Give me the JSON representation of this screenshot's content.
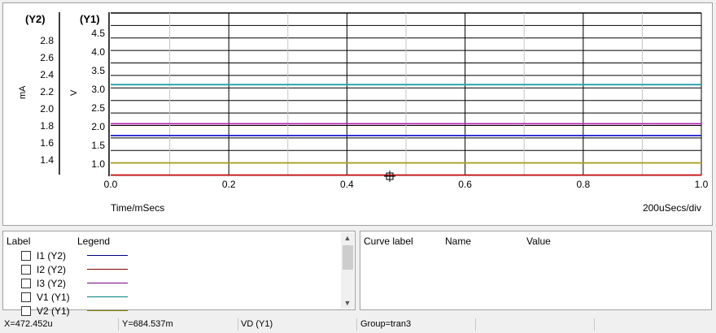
{
  "graph": {
    "y2_axis_title": "(Y2)",
    "y1_axis_title": "(Y1)",
    "y2_unit": "mA",
    "y1_unit": "V",
    "x_axis_label": "Time/mSecs",
    "x_scale_label": "200uSecs/div"
  },
  "chart_data": {
    "type": "line",
    "x_unit": "mSecs",
    "xlim": [
      0.0,
      1.0
    ],
    "x_ticks": [
      "0.0",
      "0.2",
      "0.4",
      "0.6",
      "0.8",
      "1.0"
    ],
    "y1_ticks": [
      "1.0",
      "1.5",
      "2.0",
      "2.5",
      "3.0",
      "3.5",
      "4.0",
      "4.5"
    ],
    "y2_ticks": [
      "1.4",
      "1.6",
      "1.8",
      "2.0",
      "2.2",
      "2.4",
      "2.6",
      "2.8"
    ],
    "y1_lim": [
      0.85,
      5.0
    ],
    "grid": true,
    "traces": [
      {
        "color": "#1a1ad0",
        "axis": "Y1",
        "value": 1.87
      },
      {
        "color": "#cc1010",
        "axis": "Y1",
        "value": 0.86
      },
      {
        "color": "#b020b0",
        "axis": "Y1",
        "value": 2.17
      },
      {
        "color": "#20a0a8",
        "axis": "Y1",
        "value": 3.17
      },
      {
        "color": "#a8a020",
        "axis": "Y1",
        "value": 1.17
      }
    ]
  },
  "legend": {
    "header_label": "Label",
    "header_legend": "Legend",
    "items": [
      {
        "label": "I1 (Y2)",
        "color": "#000080"
      },
      {
        "label": "I2 (Y2)",
        "color": "#800000"
      },
      {
        "label": "I3 (Y2)",
        "color": "#800080"
      },
      {
        "label": "V1 (Y1)",
        "color": "#008080"
      },
      {
        "label": "V2 (Y1)",
        "color": "#808000"
      }
    ]
  },
  "curve_info": {
    "header_curve_label": "Curve label",
    "header_name": "Name",
    "header_value": "Value"
  },
  "status": {
    "x": "X=472.452u",
    "y": "Y=684.537m",
    "curve": "VD (Y1)",
    "group": "Group=tran3"
  }
}
